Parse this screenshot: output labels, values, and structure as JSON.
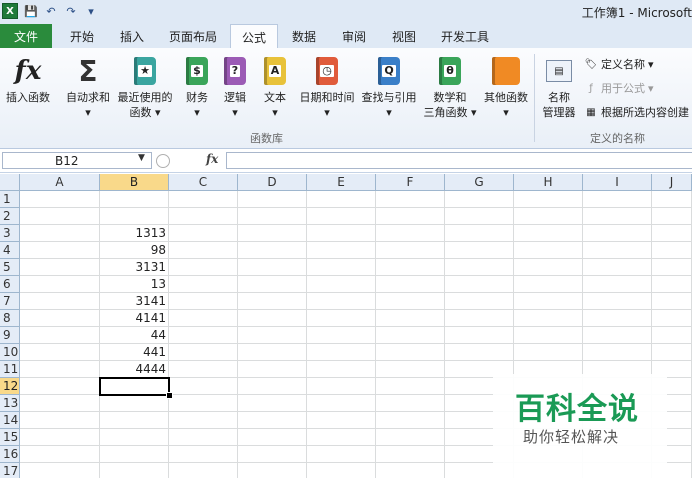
{
  "window": {
    "title": "工作簿1 - Microsoft"
  },
  "quick_access": {
    "app_icon": "X",
    "icons": [
      "save-icon",
      "undo-icon",
      "redo-icon",
      "customize-icon"
    ],
    "glyphs": [
      "💾",
      "↶",
      "↷",
      "▾"
    ]
  },
  "tabs": {
    "file": "文件",
    "items": [
      {
        "label": "开始"
      },
      {
        "label": "插入"
      },
      {
        "label": "页面布局"
      },
      {
        "label": "公式",
        "active": true
      },
      {
        "label": "数据"
      },
      {
        "label": "审阅"
      },
      {
        "label": "视图"
      },
      {
        "label": "开发工具"
      }
    ]
  },
  "ribbon": {
    "function_library": {
      "group_label": "函数库",
      "insert_function": {
        "icon_text": "fx",
        "label": "插入函数"
      },
      "autosum": {
        "icon_text": "Σ",
        "label": "自动求和"
      },
      "recent": {
        "label1": "最近使用的",
        "label2": "函数"
      },
      "financial": {
        "label": "财务"
      },
      "logical": {
        "label": "逻辑"
      },
      "text": {
        "label": "文本"
      },
      "datetime": {
        "label": "日期和时间"
      },
      "lookup": {
        "label": "查找与引用"
      },
      "math": {
        "label1": "数学和",
        "label2": "三角函数"
      },
      "other": {
        "label": "其他函数"
      }
    },
    "defined_names": {
      "group_label": "定义的名称",
      "name_manager": {
        "label1": "名称",
        "label2": "管理器"
      },
      "define_name": "定义名称",
      "use_in_formula": "用于公式",
      "create_from_selection": "根据所选内容创建"
    },
    "colors": {
      "book_financial": "#3aa55a",
      "book_logical": "#9b5bb5",
      "book_text": "#e8c23a",
      "book_datetime": "#e05b3b",
      "book_lookup": "#3a7fc8",
      "book_math": "#3aa55a",
      "book_other": "#f08a24",
      "book_recent": "#3aa5a0"
    },
    "book_glyphs": {
      "recent": "★",
      "financial": "$",
      "logical": "?",
      "text": "A",
      "datetime": "◷",
      "lookup": "Q",
      "math": "θ",
      "other": ""
    }
  },
  "formula_bar": {
    "name_box": "B12",
    "fx_label": "fx",
    "formula": ""
  },
  "sheet": {
    "columns": [
      "A",
      "B",
      "C",
      "D",
      "E",
      "F",
      "G",
      "H",
      "I",
      "J"
    ],
    "rows": [
      "1",
      "2",
      "3",
      "4",
      "5",
      "6",
      "7",
      "8",
      "9",
      "10",
      "11",
      "12",
      "13",
      "14",
      "15",
      "16",
      "17"
    ],
    "selected_cell": "B12",
    "column_b_values": {
      "3": "1313",
      "4": "98",
      "5": "3131",
      "6": "13",
      "7": "3141",
      "8": "4141",
      "9": "44",
      "10": "441",
      "11": "4444"
    }
  },
  "watermark": {
    "title": "百科全说",
    "subtitle": "助你轻松解决",
    "color": "#1a9a55"
  }
}
